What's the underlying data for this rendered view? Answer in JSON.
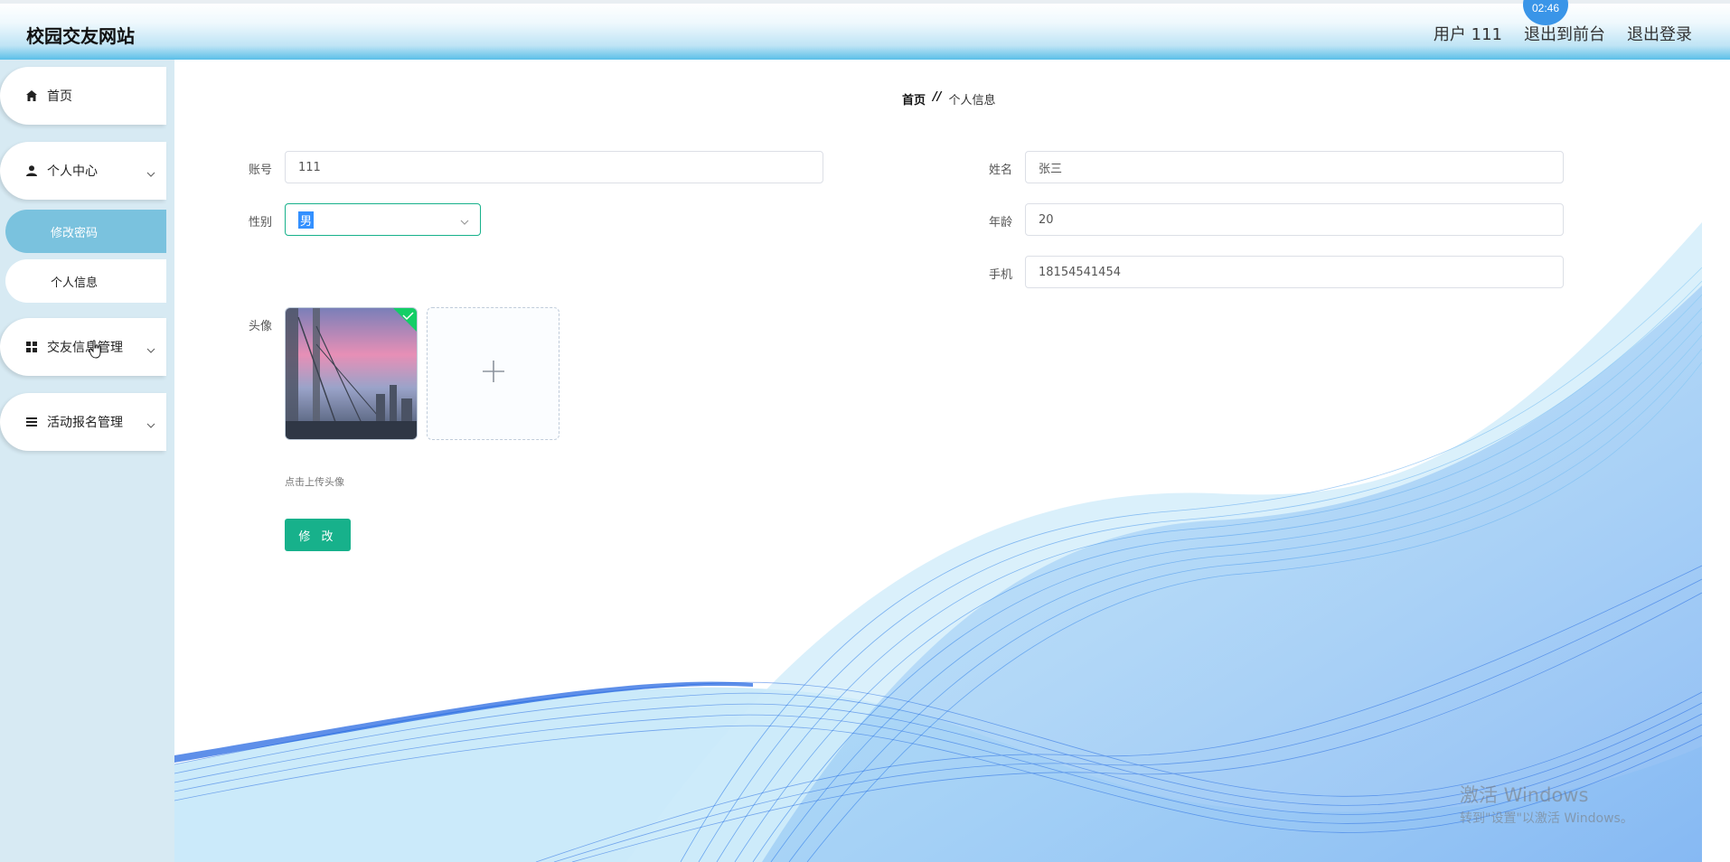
{
  "header": {
    "title": "校园交友网站",
    "user_label": "用户 111",
    "front_label": "退出到前台",
    "logout_label": "退出登录",
    "clock": "02:46"
  },
  "sidebar": {
    "home": "首页",
    "personal_center": "个人中心",
    "change_password": "修改密码",
    "personal_info": "个人信息",
    "dating_info": "交友信息管理",
    "activity_signup": "活动报名管理"
  },
  "breadcrumb": {
    "home": "首页",
    "separator": "//",
    "current": "个人信息"
  },
  "form": {
    "account_label": "账号",
    "account_value": "111",
    "name_label": "姓名",
    "name_value": "张三",
    "gender_label": "性别",
    "gender_value": "男",
    "age_label": "年龄",
    "age_value": "20",
    "phone_label": "手机",
    "phone_value": "18154541454",
    "avatar_label": "头像",
    "upload_tip": "点击上传头像",
    "submit_label": "修 改"
  },
  "watermark": {
    "line1": "激活 Windows",
    "line2": "转到\"设置\"以激活 Windows。"
  },
  "colors": {
    "accent": "#17b18b",
    "sidebar_bg": "#d7eaf3",
    "active_item": "#7ac2de"
  }
}
